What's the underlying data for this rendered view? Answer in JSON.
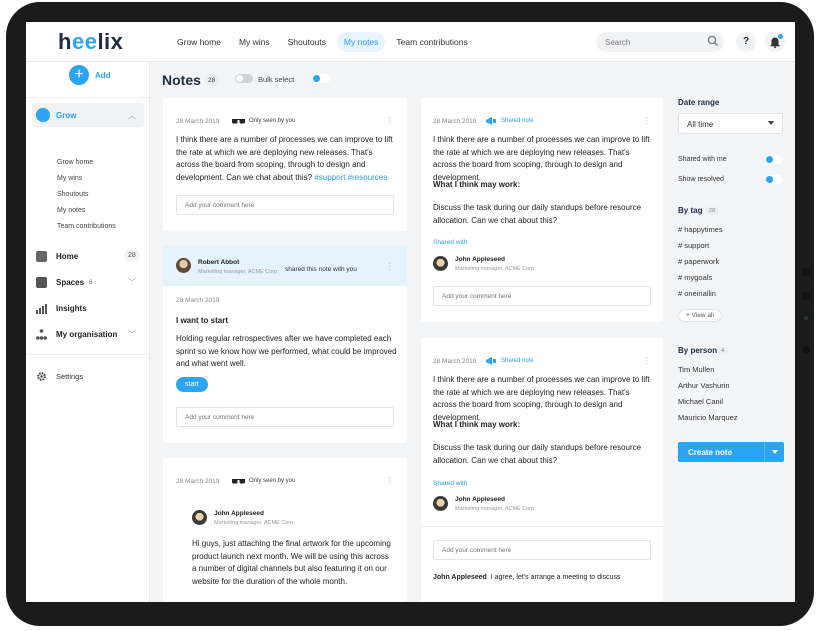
{
  "brand": {
    "logo_text_1": "h",
    "logo_text_2": "ee",
    "logo_text_3": "lix",
    "accent": "#2aa4f4"
  },
  "topnav": {
    "items": [
      {
        "label": "Grow home",
        "active": false
      },
      {
        "label": "My wins",
        "active": false
      },
      {
        "label": "Shoutouts",
        "active": false
      },
      {
        "label": "My notes",
        "active": true
      },
      {
        "label": "Team contributions",
        "active": false
      }
    ],
    "search_placeholder": "Search",
    "help_label": "?"
  },
  "sidebar": {
    "add_label": "Add",
    "grow_label": "Grow",
    "grow_subitems": [
      "Grow home",
      "My wins",
      "Shoutouts",
      "My notes",
      "Team contributions"
    ],
    "home_label": "Home",
    "home_count": "28",
    "spaces_label": "Spaces",
    "spaces_count": "6",
    "insights_label": "Insights",
    "org_label": "My organisation",
    "settings_label": "Settings"
  },
  "header": {
    "title": "Notes",
    "count": "28",
    "bulk_label": "Bulk select"
  },
  "cards": {
    "c1": {
      "date": "28 March 2019",
      "visibility": "Only seen by you",
      "text": "I think there are a number of processes we can improve to lift the rate at which we are deploying new releases. That's across the board from scoping, through to design and development. Can we chat about this?",
      "tags": "#support #resources",
      "comment_placeholder": "Add your comment here"
    },
    "c2": {
      "sharer_name": "Robert Abbot",
      "sharer_role": "Marketing manager, ACME Corp",
      "shared_msg": "shared this note with you",
      "date": "28 March 2019",
      "heading": "I want to start",
      "text": "Holding regular retrospectives after we have completed each sprint so we know how we performed, what could be improved and what went well.",
      "button": "start",
      "comment_placeholder": "Add your comment here"
    },
    "c3": {
      "date": "28 March 2019",
      "visibility": "Only seen by you",
      "person_name": "John Appleseed",
      "person_role": "Marketing manager, ACME Corp",
      "text": "Hi guys, just attaching the final artwork for the upcoming product launch next month. We will be using this across a number of digital channels but also featuring it on our website for the duration of the whole month."
    },
    "c4": {
      "date": "28 March 2019",
      "visibility": "Shared note",
      "text": "I think there are a number of processes we can improve to lift the rate at which we are deploying new releases. That's across the board from scoping, through to design and development.",
      "heading": "What I think may work:",
      "text2": "Discuss the task during our daily standups before resource allocation. Can we chat about this?",
      "shared_with": "Shared with",
      "person_name": "John Appleseed",
      "person_role": "Marketing manager, ACME Corp",
      "comment_placeholder": "Add your comment here"
    },
    "c5": {
      "date": "28 March 2019",
      "visibility": "Shared note",
      "text": "I think there are a number of processes we can improve to lift the rate at which we are deploying new releases. That's across the board from scoping, through to design and development.",
      "heading": "What I think may work:",
      "text2": "Discuss the task during our daily standups before resource allocation. Can we chat about this?",
      "shared_with": "Shared with",
      "person_name": "John Appleseed",
      "person_role": "Marketing manager, ACME Corp",
      "comment_placeholder": "Add your comment here",
      "reply_name": "John Appleseed",
      "reply_text": "I agree, let's arrange a meeting to discuss"
    }
  },
  "filters": {
    "date_range_label": "Date range",
    "date_range_value": "All time",
    "shared_with_me": "Shared with me",
    "show_resolved": "Show resolved",
    "by_tag_label": "By tag",
    "by_tag_count": "28",
    "tags": [
      "# happytimes",
      "# support",
      "# paperwork",
      "# mygoals",
      "# oneinallin"
    ],
    "view_all": "+  View all",
    "by_person_label": "By person",
    "by_person_count": "4",
    "people": [
      "Tim Mullen",
      "Arthur Vashurin",
      "Michael Canil",
      "Mauricio Marquez"
    ],
    "create_note": "Create note"
  }
}
